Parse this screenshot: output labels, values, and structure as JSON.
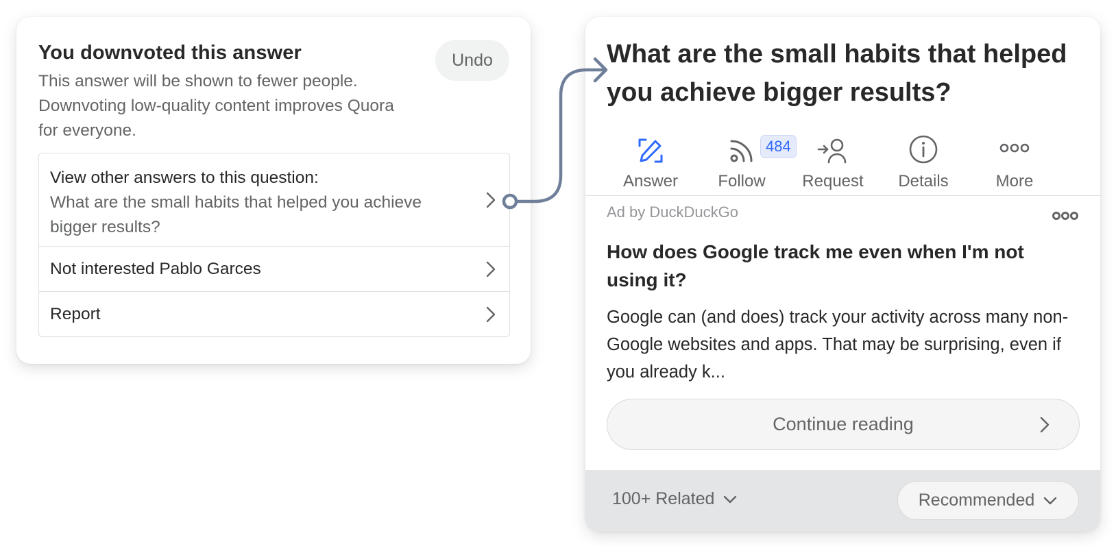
{
  "downvote_panel": {
    "title": "You downvoted this answer",
    "description": "This answer will be shown to fewer people. Downvoting low-quality content improves Quora for everyone.",
    "undo_label": "Undo",
    "options": [
      {
        "label": "View other answers to this question:",
        "sublabel": "What are the small habits that helped you achieve bigger results?",
        "icon": "chevron-right-icon"
      },
      {
        "label": "Not interested Pablo Garces",
        "icon": "chevron-right-icon"
      },
      {
        "label": "Report",
        "icon": "chevron-right-icon"
      }
    ]
  },
  "question_panel": {
    "title": "What are the small habits that helped you achieve bigger results?",
    "actions": [
      {
        "label": "Answer",
        "icon": "pencil-edit-icon",
        "active": true
      },
      {
        "label": "Follow",
        "icon": "rss-follow-icon",
        "badge": "484"
      },
      {
        "label": "Request",
        "icon": "request-person-icon"
      },
      {
        "label": "Details",
        "icon": "info-icon"
      },
      {
        "label": "More",
        "icon": "more-dots-icon"
      }
    ],
    "ad": {
      "sponsor": "Ad by DuckDuckGo",
      "title": "How does Google track me even when I'm not using it?",
      "body": "Google can (and does) track your activity across many non-Google websites and apps. That may be surprising, even if you already k...",
      "continue_label": "Continue reading"
    },
    "footer": {
      "related_label": "100+ Related",
      "sort_label": "Recommended"
    }
  },
  "colors": {
    "accent_blue": "#2e69ff",
    "connector": "#6f7f99",
    "text_primary": "#282829",
    "text_secondary": "#636466",
    "footer_bg": "#e4e5e7"
  }
}
